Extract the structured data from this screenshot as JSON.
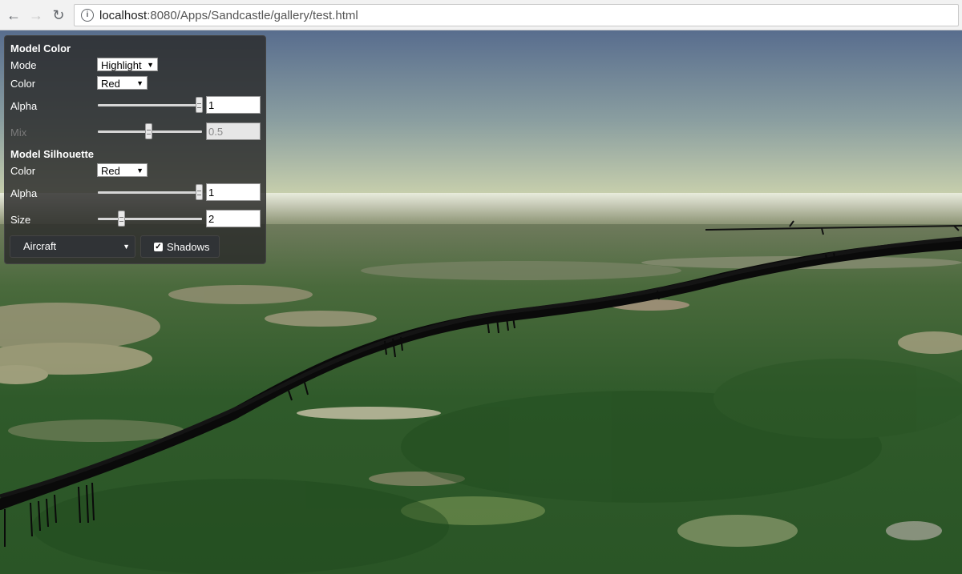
{
  "browser": {
    "url_host": "localhost",
    "url_rest": ":8080/Apps/Sandcastle/gallery/test.html",
    "icons": {
      "back": "arrow-left-icon",
      "forward": "arrow-right-icon",
      "reload": "reload-icon",
      "info": "info-icon"
    }
  },
  "toolbar": {
    "model_color": {
      "title": "Model Color",
      "mode_label": "Mode",
      "mode_value": "Highlight",
      "color_label": "Color",
      "color_value": "Red",
      "alpha_label": "Alpha",
      "alpha_value": "1",
      "alpha_fraction": 1,
      "mix_label": "Mix",
      "mix_value": "0.5",
      "mix_fraction": 0.5
    },
    "model_silhouette": {
      "title": "Model Silhouette",
      "color_label": "Color",
      "color_value": "Red",
      "alpha_label": "Alpha",
      "alpha_value": "1",
      "alpha_fraction": 1,
      "size_label": "Size",
      "size_value": "2",
      "size_fraction": 0.23
    },
    "model_select_value": "Aircraft",
    "shadows_label": "Shadows",
    "shadows_checked": true
  },
  "colors": {
    "sky_top": "#5a7090",
    "sky_horizon": "#c9cfb2",
    "terrain": "#2e5a28",
    "panel": "#2a2a2a"
  }
}
